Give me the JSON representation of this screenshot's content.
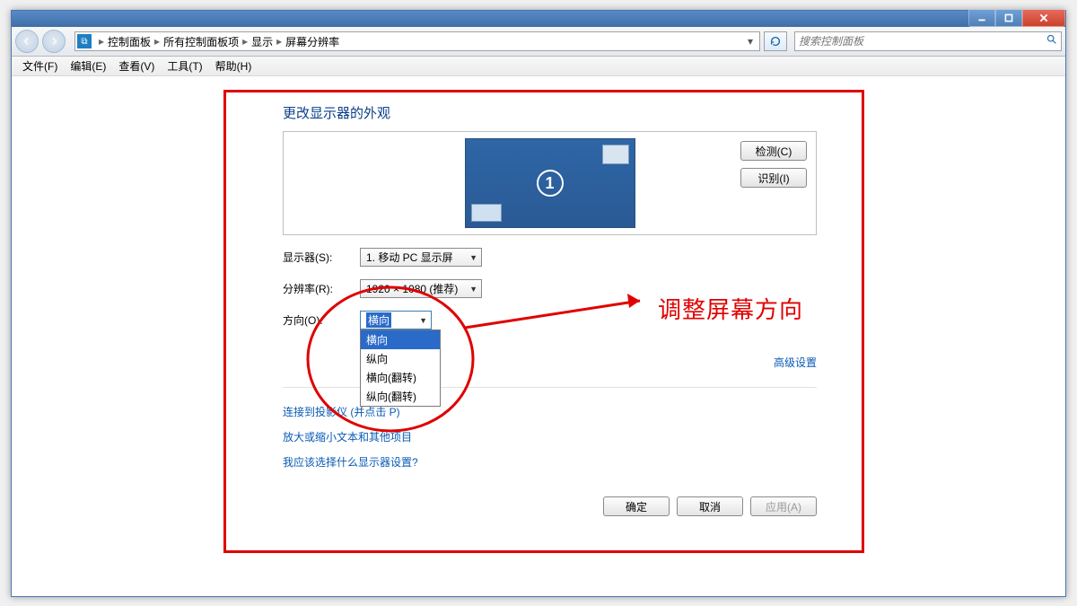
{
  "titlebar": {
    "min": "—",
    "max": "☐",
    "close": "✕"
  },
  "nav": {
    "breadcrumb": [
      "控制面板",
      "所有控制面板项",
      "显示",
      "屏幕分辨率"
    ],
    "search_placeholder": "搜索控制面板"
  },
  "menu": {
    "items": [
      "文件(F)",
      "编辑(E)",
      "查看(V)",
      "工具(T)",
      "帮助(H)"
    ]
  },
  "page": {
    "title": "更改显示器的外观",
    "monitor_number": "1",
    "detect": "检测(C)",
    "identify": "识别(I)",
    "display_label": "显示器(S):",
    "display_value": "1. 移动 PC 显示屏",
    "resolution_label": "分辨率(R):",
    "resolution_value": "1920 × 1080 (推荐)",
    "orientation_label": "方向(O):",
    "orientation_value": "横向",
    "orientation_options": [
      "横向",
      "纵向",
      "横向(翻转)",
      "纵向(翻转)"
    ],
    "advanced": "高级设置",
    "projector_link_pre": "连接到投影仪 (",
    "projector_link_post": "并点击 P)",
    "zoom_link": "放大或缩小文本和其他项目",
    "which_link": "我应该选择什么显示器设置?",
    "ok": "确定",
    "cancel": "取消",
    "apply": "应用(A)"
  },
  "annotation": {
    "text": "调整屏幕方向"
  }
}
